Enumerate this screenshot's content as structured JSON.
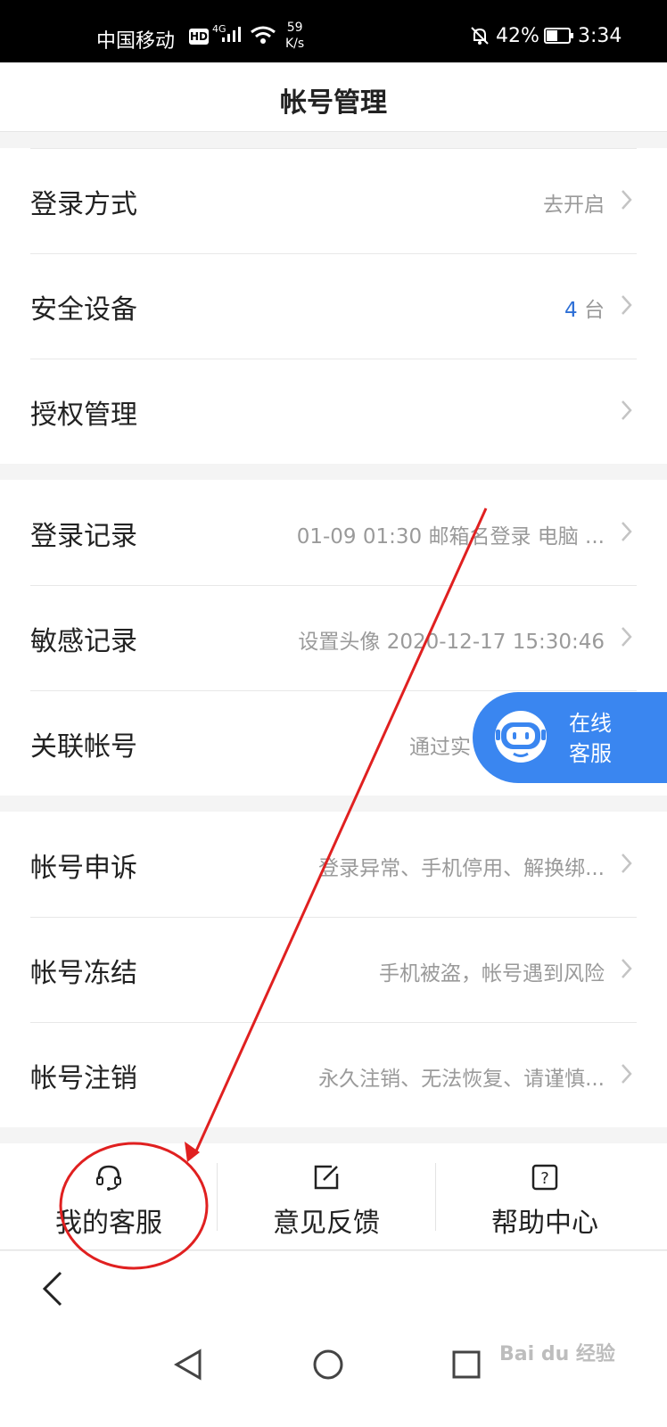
{
  "status_bar": {
    "carrier": "中国移动",
    "hd": "HD",
    "network": "4G",
    "speed_value": "59",
    "speed_unit": "K/s",
    "battery": "42%",
    "time": "3:34"
  },
  "header": {
    "title": "帐号管理"
  },
  "groups": [
    {
      "rows": [
        {
          "label": "登录方式",
          "value": "去开启"
        },
        {
          "label": "安全设备",
          "value_accent": "4",
          "value": " 台"
        },
        {
          "label": "授权管理",
          "value": ""
        }
      ]
    },
    {
      "rows": [
        {
          "label": "登录记录",
          "value": "01-09 01:30 邮箱名登录 电脑 ..."
        },
        {
          "label": "敏感记录",
          "value": "设置头像 2020-12-17 15:30:46"
        },
        {
          "label": "关联帐号",
          "value": "通过实"
        }
      ]
    },
    {
      "rows": [
        {
          "label": "帐号申诉",
          "value": "登录异常、手机停用、解换绑..."
        },
        {
          "label": "帐号冻结",
          "value": "手机被盗，帐号遇到风险"
        },
        {
          "label": "帐号注销",
          "value": "永久注销、无法恢复、请谨慎..."
        }
      ]
    }
  ],
  "floating_service": {
    "label": "在线客服"
  },
  "tabs": [
    {
      "label": "我的客服",
      "icon": "headset-icon"
    },
    {
      "label": "意见反馈",
      "icon": "edit-icon"
    },
    {
      "label": "帮助中心",
      "icon": "help-icon"
    }
  ],
  "watermark": "Bai du 经验",
  "colors": {
    "accent_blue": "#2d6fd6",
    "float_blue": "#3a86f0",
    "annotation_red": "#e02020"
  }
}
